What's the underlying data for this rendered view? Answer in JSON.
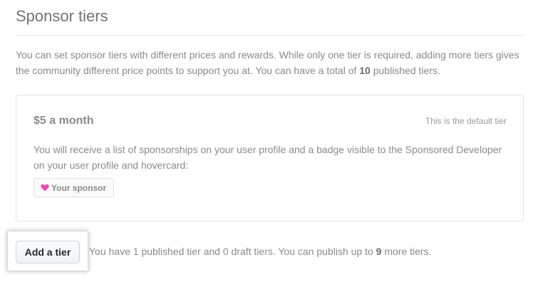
{
  "page": {
    "title": "Sponsor tiers"
  },
  "intro": {
    "text_before": "You can set sponsor tiers with different prices and rewards. While only one tier is required, adding more tiers gives the community different price points to support you at. You can have a total of ",
    "max_tiers": "10",
    "text_after": " published tiers."
  },
  "tier": {
    "price": "$5 a month",
    "default_label": "This is the default tier",
    "description": "You will receive a list of sponsorships on your user profile and a badge visible to the Sponsored Developer on your user profile and hovercard:",
    "badge": {
      "icon": "heart-icon",
      "label": "Your sponsor",
      "icon_color": "#ea4aaa"
    }
  },
  "actions": {
    "add_tier_label": "Add a tier"
  },
  "status": {
    "text_before": "You have 1 published tier and 0 draft tiers. You can publish up to ",
    "remaining": "9",
    "text_after": " more tiers."
  }
}
